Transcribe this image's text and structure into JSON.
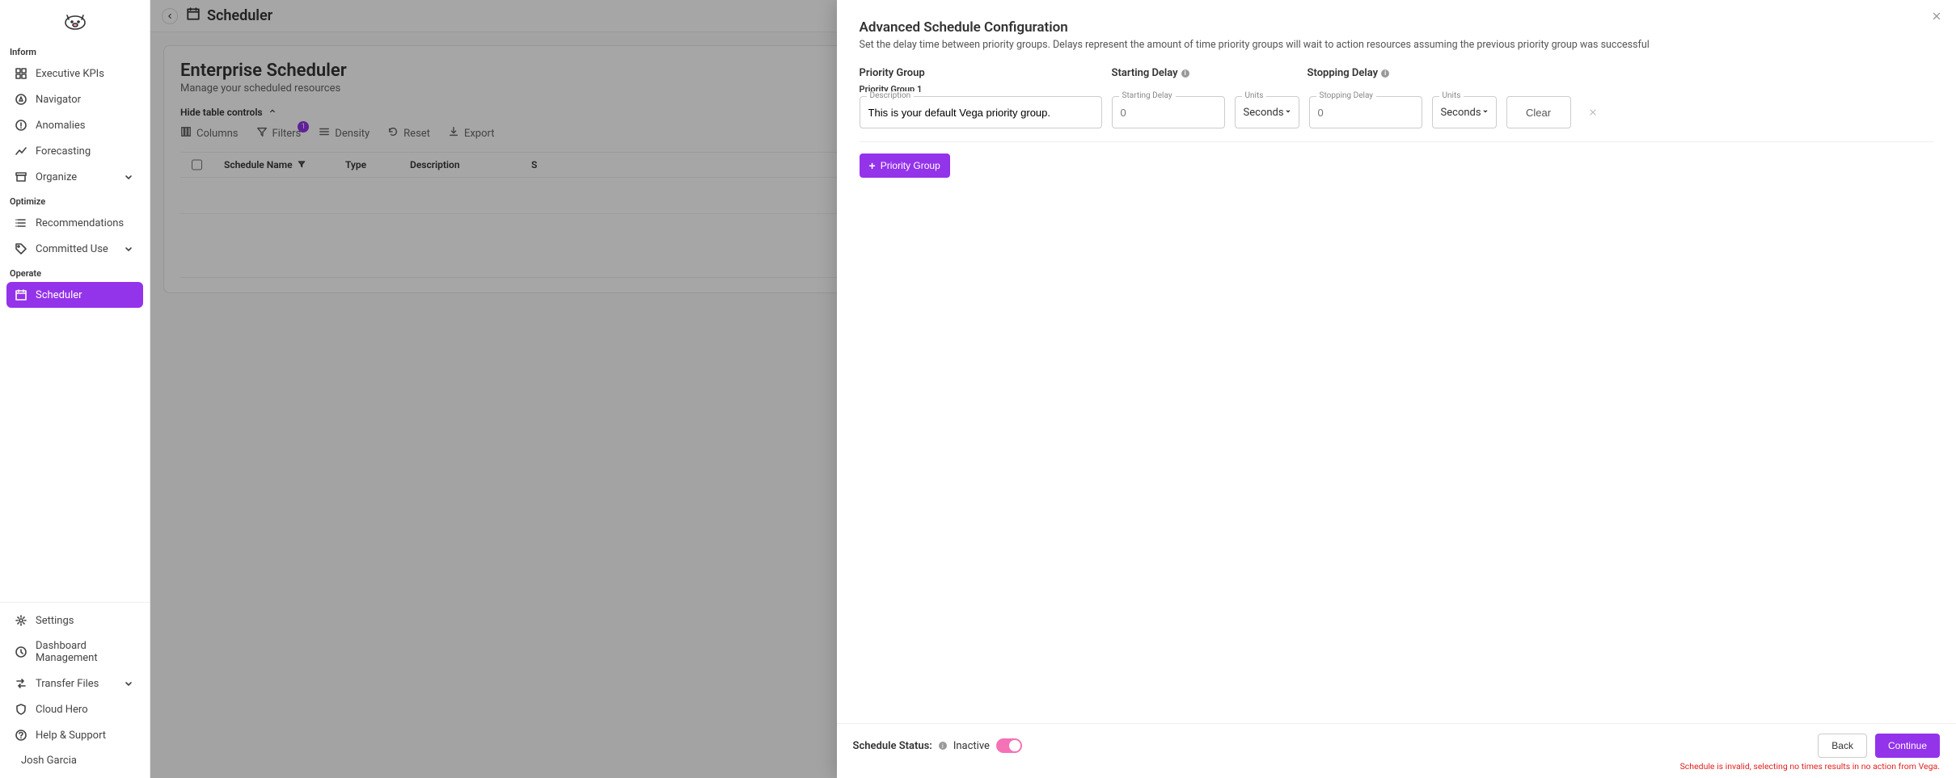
{
  "app": {
    "page_title": "Scheduler"
  },
  "sidebar": {
    "sections": {
      "inform": {
        "label": "Inform"
      },
      "optimize": {
        "label": "Optimize"
      },
      "operate": {
        "label": "Operate"
      }
    },
    "items": {
      "executive_kpis": {
        "label": "Executive KPIs"
      },
      "navigator": {
        "label": "Navigator"
      },
      "anomalies": {
        "label": "Anomalies"
      },
      "forecasting": {
        "label": "Forecasting"
      },
      "organize": {
        "label": "Organize"
      },
      "recommendations": {
        "label": "Recommendations"
      },
      "committed_use": {
        "label": "Committed Use"
      },
      "scheduler": {
        "label": "Scheduler"
      },
      "settings": {
        "label": "Settings"
      },
      "dashboard_mgmt": {
        "label": "Dashboard Management"
      },
      "transfer_files": {
        "label": "Transfer Files"
      },
      "cloud_hero": {
        "label": "Cloud Hero"
      },
      "help_support": {
        "label": "Help & Support"
      }
    },
    "user": {
      "name": "Josh Garcia"
    }
  },
  "scheduler_page": {
    "title": "Enterprise Scheduler",
    "subtitle": "Manage your scheduled resources",
    "hide_controls": "Hide table controls",
    "toolbar": {
      "columns": "Columns",
      "filters": "Filters",
      "filters_badge": "1",
      "density": "Density",
      "reset": "Reset",
      "export": "Export"
    },
    "columns": {
      "name": "Schedule Name",
      "type": "Type",
      "description": "Description",
      "s": "S"
    }
  },
  "drawer": {
    "title": "Advanced Schedule Configuration",
    "desc": "Set the delay time between priority groups. Delays represent the amount of time priority groups will wait to action resources assuming the previous priority group was successful",
    "headers": {
      "priority_group": "Priority Group",
      "starting_delay": "Starting Delay",
      "stopping_delay": "Stopping Delay"
    },
    "group1": {
      "title": "Priority Group 1",
      "description_label": "Description",
      "description_value": "This is your default Vega priority group.",
      "starting_label": "Starting Delay",
      "starting_placeholder": "0",
      "stopping_label": "Stopping Delay",
      "stopping_placeholder": "0",
      "units_label": "Units",
      "units_value": "Seconds",
      "clear": "Clear"
    },
    "add_button": "Priority Group",
    "footer": {
      "status_label": "Schedule Status:",
      "inactive": "Inactive",
      "back": "Back",
      "continue": "Continue",
      "error": "Schedule is invalid, selecting no times results in no action from Vega."
    }
  }
}
